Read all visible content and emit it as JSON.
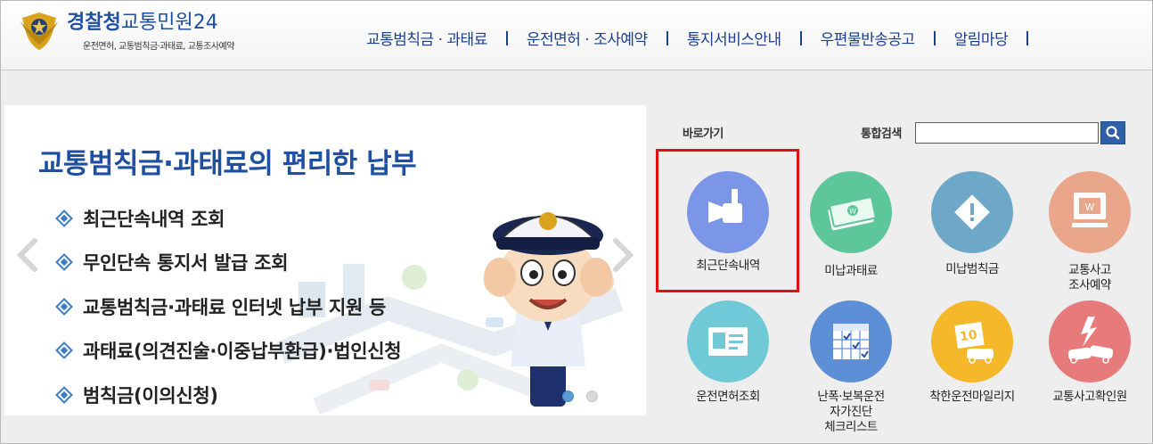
{
  "header": {
    "logo_main": "경찰청",
    "logo_sub_title": "교통민원24",
    "logo_tagline": "운전면허, 교통범칙금·과태료, 교통조사예약",
    "nav": [
      {
        "label": "교통범칙금 · 과태료"
      },
      {
        "label": "운전면허 · 조사예약"
      },
      {
        "label": "통지서비스안내"
      },
      {
        "label": "우편물반송공고"
      },
      {
        "label": "알림마당"
      }
    ]
  },
  "banner": {
    "title": "교통범칙금·과태료의 편리한 납부",
    "items": [
      {
        "label": "최근단속내역 조회"
      },
      {
        "label": "무인단속 통지서 발급 조회"
      },
      {
        "label": "교통범칙금·과태료 인터넷 납부 지원 등"
      },
      {
        "label": "과태료(의견진술·이중납부환급)·법인신청"
      },
      {
        "label": "범칙금(이의신청)"
      }
    ],
    "slide_index": 1,
    "slide_count": 2
  },
  "quick": {
    "label": "바로가기",
    "search_label": "통합검색",
    "search_value": "",
    "items": [
      {
        "label": "최근단속내역",
        "icon": "camera-icon",
        "color": "#7b96e6"
      },
      {
        "label": "미납과태료",
        "icon": "money-icon",
        "color": "#5dc69a"
      },
      {
        "label": "미납범칙금",
        "icon": "warning-icon",
        "color": "#6ea8c9"
      },
      {
        "label": "교통사고\n조사예약",
        "icon": "monitor-icon",
        "color": "#eaa68a"
      },
      {
        "label": "운전면허조회",
        "icon": "license-card-icon",
        "color": "#6fc9d7"
      },
      {
        "label": "난폭·보복운전\n자가진단\n체크리스트",
        "icon": "calendar-check-icon",
        "color": "#5c8fd6"
      },
      {
        "label": "착한운전마일리지",
        "icon": "mileage-car-icon",
        "color": "#f5b82a"
      },
      {
        "label": "교통사고확인원",
        "icon": "accident-icon",
        "color": "#e77a7a"
      }
    ]
  },
  "colors": {
    "brand_blue": "#1f4fa1",
    "highlight_red": "#e01010"
  }
}
